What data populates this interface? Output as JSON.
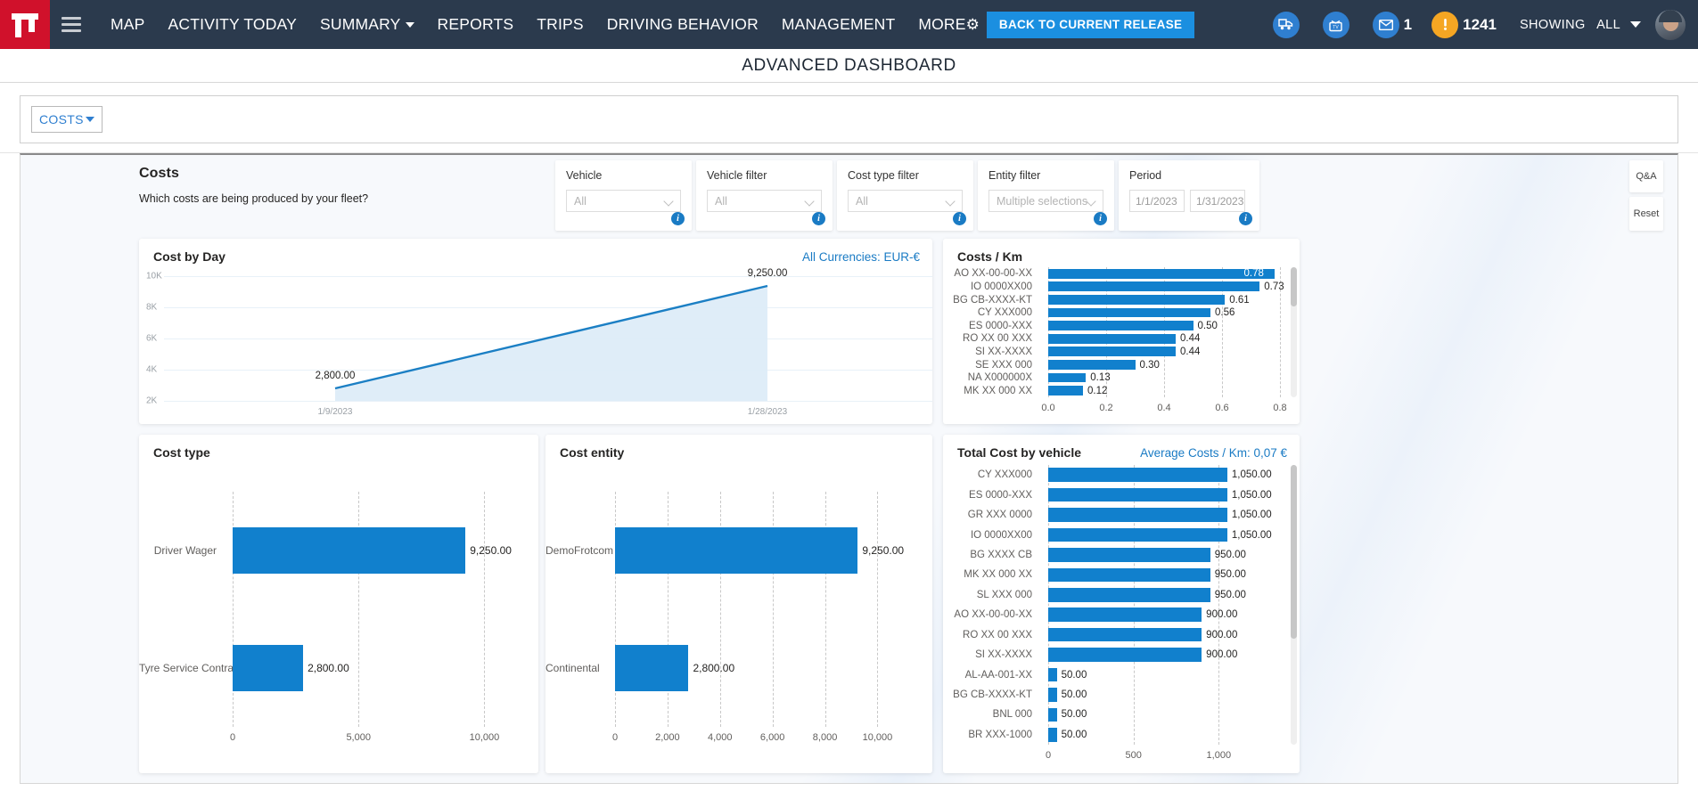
{
  "navbar": {
    "logo_icon": "frotcom-logo-icon",
    "menu_icon": "hamburger-menu-icon",
    "items": [
      {
        "label": "MAP",
        "has_caret": false
      },
      {
        "label": "ACTIVITY TODAY",
        "has_caret": false
      },
      {
        "label": "SUMMARY",
        "has_caret": true
      },
      {
        "label": "REPORTS",
        "has_caret": false
      },
      {
        "label": "TRIPS",
        "has_caret": false
      },
      {
        "label": "DRIVING BEHAVIOR",
        "has_caret": false
      },
      {
        "label": "MANAGEMENT",
        "has_caret": false
      },
      {
        "label": "MORE",
        "has_caret": false
      }
    ],
    "gear_icon": "gear-icon",
    "release_button": "BACK TO CURRENT RELEASE",
    "truck_icon": "truck-report-icon",
    "tv_icon": "tv-icon",
    "mail_icon": "envelope-icon",
    "mail_count": "1",
    "alert_icon": "alert-exclamation-icon",
    "alert_count": "1241",
    "showing_label": "SHOWING",
    "showing_value": "ALL",
    "avatar": "user-avatar"
  },
  "page": {
    "title": "ADVANCED DASHBOARD"
  },
  "dashboard_selector": {
    "label": "COSTS"
  },
  "report": {
    "title": "Costs",
    "subtitle": "Which costs are being produced by your fleet?"
  },
  "filters": [
    {
      "label": "Vehicle",
      "value": "All",
      "info_icon": "info-icon"
    },
    {
      "label": "Vehicle filter",
      "value": "All",
      "info_icon": "info-icon"
    },
    {
      "label": "Cost type filter",
      "value": "All",
      "info_icon": "info-icon"
    },
    {
      "label": "Entity filter",
      "value": "Multiple selections",
      "info_icon": "info-icon"
    }
  ],
  "period_filter": {
    "label": "Period",
    "from": "1/1/2023",
    "to": "1/31/2023",
    "info_icon": "info-icon"
  },
  "side_buttons": [
    {
      "label": "Q&A"
    },
    {
      "label": "Reset"
    }
  ],
  "panels": {
    "cost_by_day": {
      "title": "Cost by Day",
      "right_label": "All Currencies: EUR-€"
    },
    "costs_per_km": {
      "title": "Costs / Km",
      "right_label": ""
    },
    "cost_type": {
      "title": "Cost type",
      "right_label": ""
    },
    "cost_entity": {
      "title": "Cost entity",
      "right_label": ""
    },
    "total_cost_by_vehicle": {
      "title": "Total Cost by vehicle",
      "right_label": "Average Costs / Km: 0,07 €"
    }
  },
  "colors": {
    "navbar": "#2b3a4d",
    "logo_red": "#d0112b",
    "accent_blue": "#1180cd",
    "link_blue": "#1a7bc4",
    "release_button": "#1b8fe0",
    "alert_orange": "#f5a623"
  },
  "chart_data": [
    {
      "id": "cost_by_day",
      "type": "area",
      "title": "Cost by Day",
      "annotation": "All Currencies: EUR-€",
      "x": [
        "1/9/2023",
        "1/28/2023"
      ],
      "xlabel": "",
      "ylabel": "",
      "ylim": [
        2000,
        10000
      ],
      "yticks": [
        2000,
        4000,
        6000,
        8000,
        10000
      ],
      "ytick_labels": [
        "2K",
        "4K",
        "6K",
        "8K",
        "10K"
      ],
      "values": [
        2800,
        9250
      ],
      "data_labels": [
        "2,800.00",
        "9,250.00"
      ],
      "grid": true,
      "legend": "none"
    },
    {
      "id": "costs_per_km",
      "type": "bar",
      "orientation": "horizontal",
      "title": "Costs / Km",
      "categories": [
        "AO XX-00-00-XX",
        "IO 0000XX00",
        "BG CB-XXXX-KT",
        "CY XXX000",
        "ES 0000-XXX",
        "RO XX 00 XXX",
        "SI XX-XXXX",
        "SE XXX 000",
        "NA X000000X",
        "MK XX 000 XX"
      ],
      "values": [
        0.78,
        0.73,
        0.61,
        0.56,
        0.5,
        0.44,
        0.44,
        0.3,
        0.13,
        0.12
      ],
      "data_labels": [
        "0.78",
        "0.73",
        "0.61",
        "0.56",
        "0.50",
        "0.44",
        "0.44",
        "0.30",
        "0.13",
        "0.12"
      ],
      "xlim": [
        0,
        0.8
      ],
      "xticks": [
        0.0,
        0.2,
        0.4,
        0.6,
        0.8
      ],
      "xtick_labels": [
        "0.0",
        "0.2",
        "0.4",
        "0.6",
        "0.8"
      ],
      "grid": true,
      "scrollable": true
    },
    {
      "id": "cost_type",
      "type": "bar",
      "orientation": "horizontal",
      "title": "Cost type",
      "categories": [
        "Driver Wager",
        "Tyre Service Contract"
      ],
      "values": [
        9250,
        2800
      ],
      "data_labels": [
        "9,250.00",
        "2,800.00"
      ],
      "xlim": [
        0,
        10800
      ],
      "xticks": [
        0,
        5000,
        10000
      ],
      "xtick_labels": [
        "0",
        "5,000",
        "10,000"
      ],
      "grid": true
    },
    {
      "id": "cost_entity",
      "type": "bar",
      "orientation": "horizontal",
      "title": "Cost entity",
      "categories": [
        "DemoFrotcom",
        "Continental"
      ],
      "values": [
        9250,
        2800
      ],
      "data_labels": [
        "9,250.00",
        "2,800.00"
      ],
      "xlim": [
        0,
        10800
      ],
      "xticks": [
        0,
        2000,
        4000,
        6000,
        8000,
        10000
      ],
      "xtick_labels": [
        "0",
        "2,000",
        "4,000",
        "6,000",
        "8,000",
        "10,000"
      ],
      "grid": true
    },
    {
      "id": "total_cost_by_vehicle",
      "type": "bar",
      "orientation": "horizontal",
      "title": "Total Cost by vehicle",
      "annotation": "Average Costs / Km: 0,07 €",
      "categories": [
        "CY XXX000",
        "ES 0000-XXX",
        "GR XXX 0000",
        "IO 0000XX00",
        "BG XXXX CB",
        "MK XX 000 XX",
        "SL XXX 000",
        "AO XX-00-00-XX",
        "RO XX 00 XXX",
        "SI XX-XXXX",
        "AL-AA-001-XX",
        "BG CB-XXXX-KT",
        "BNL 000",
        "BR XXX-1000"
      ],
      "values": [
        1050,
        1050,
        1050,
        1050,
        950,
        950,
        950,
        900,
        900,
        900,
        50,
        50,
        50,
        50
      ],
      "data_labels": [
        "1,050.00",
        "1,050.00",
        "1,050.00",
        "1,050.00",
        "950.00",
        "950.00",
        "950.00",
        "900.00",
        "900.00",
        "900.00",
        "50.00",
        "50.00",
        "50.00",
        "50.00"
      ],
      "xlim": [
        0,
        1150
      ],
      "xticks": [
        0,
        500,
        1000
      ],
      "xtick_labels": [
        "0",
        "500",
        "1,000"
      ],
      "grid": true,
      "scrollable": true
    }
  ]
}
